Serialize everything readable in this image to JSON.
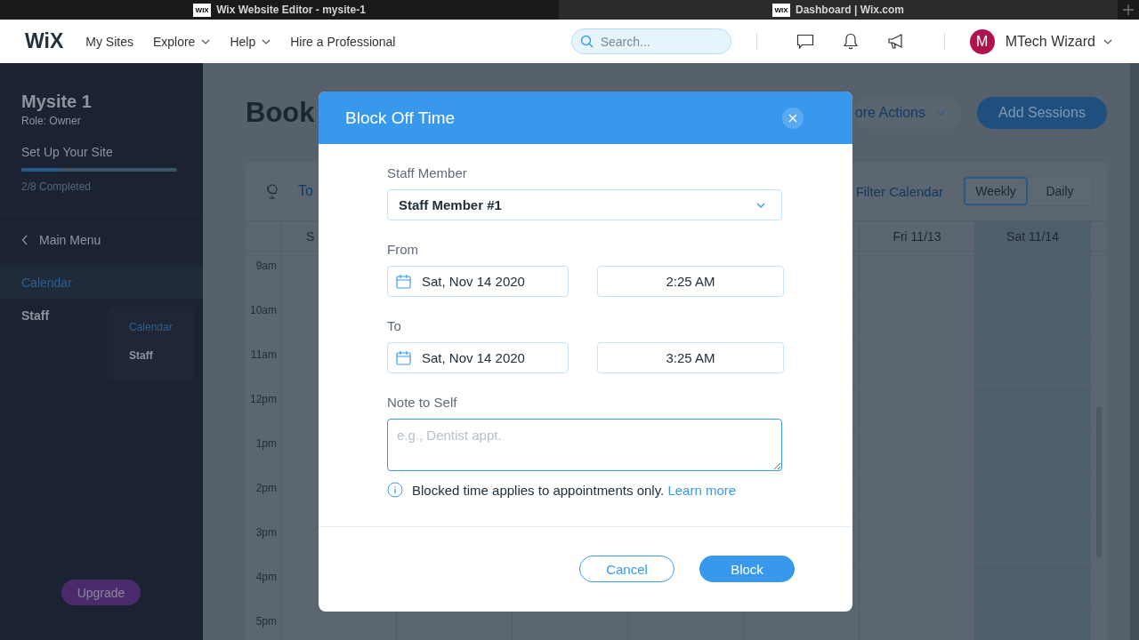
{
  "browser_tabs": [
    {
      "favicon": "WIX",
      "title": "Wix Website Editor - mysite-1",
      "selected": true
    },
    {
      "favicon": "WIX",
      "title": "Dashboard | Wix.com",
      "selected": false
    }
  ],
  "top_nav": {
    "logo": "WiX",
    "items": [
      {
        "label": "My Sites",
        "has_menu": false
      },
      {
        "label": "Explore",
        "has_menu": true
      },
      {
        "label": "Help",
        "has_menu": true
      },
      {
        "label": "Hire a Professional",
        "has_menu": false
      }
    ],
    "search": {
      "placeholder": "Search..."
    },
    "user": {
      "initial": "M",
      "name": "MTech Wizard"
    }
  },
  "sidebar": {
    "site_name": "Mysite 1",
    "role": "Role: Owner",
    "setup": {
      "title": "Set Up Your Site",
      "level": 0.25,
      "status": "2/8 Completed"
    },
    "back": "Main Menu",
    "items": [
      {
        "label": "Calendar",
        "selected": true
      },
      {
        "label": "Staff",
        "selected": false
      }
    ],
    "flyout": [
      {
        "label": "Calendar",
        "selected": true
      },
      {
        "label": "Staff",
        "selected": false
      }
    ],
    "upgrade": "Upgrade"
  },
  "page": {
    "title": "Book",
    "more_actions": "ore Actions",
    "add_sessions": "Add Sessions",
    "today": "To",
    "filter": "Filter Calendar",
    "views": [
      {
        "label": "Weekly",
        "selected": true
      },
      {
        "label": "Daily",
        "selected": false
      }
    ],
    "day_headers_left": [
      "S"
    ],
    "day_headers_right": [
      {
        "label": "Fri 11/13",
        "selected": false
      },
      {
        "label": "Sat 11/14",
        "selected": true
      }
    ],
    "hours": [
      "9am",
      "10am",
      "11am",
      "12pm",
      "1pm",
      "2pm",
      "3pm",
      "4pm",
      "5pm"
    ]
  },
  "modal": {
    "title": "Block Off Time",
    "staff_label": "Staff Member",
    "staff_value": "Staff Member #1",
    "from_label": "From",
    "from_date": "Sat, Nov 14 2020",
    "from_time": "2:25 AM",
    "to_label": "To",
    "to_date": "Sat, Nov 14 2020",
    "to_time": "3:25 AM",
    "note_label": "Note to Self",
    "note_placeholder": "e.g., Dentist appt.",
    "info": "Blocked time applies to appointments only.",
    "learn_more": "Learn more",
    "cancel": "Cancel",
    "block": "Block"
  }
}
